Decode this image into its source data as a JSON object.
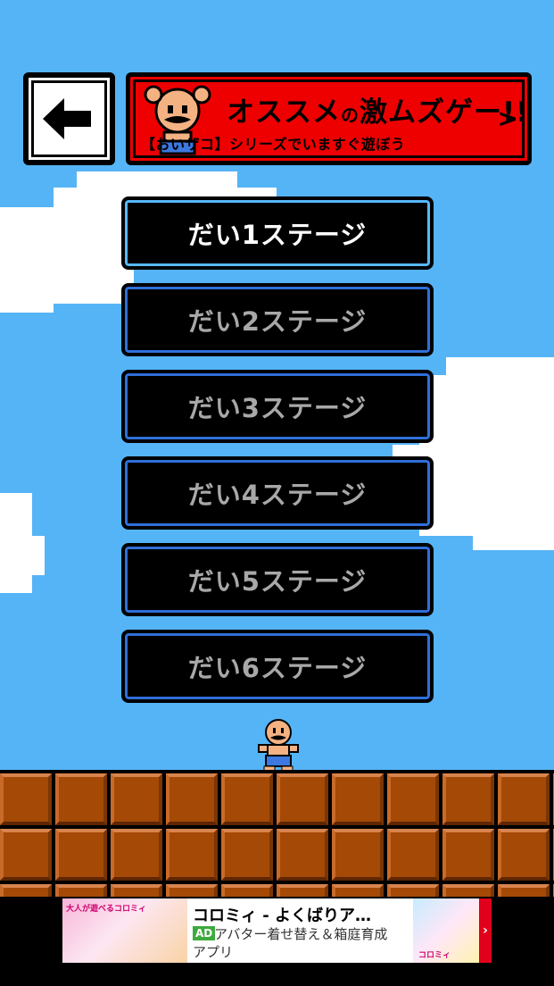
{
  "banner": {
    "title_main": "オススメ",
    "title_particle": "の",
    "title_rest": "激ムズゲー!!",
    "subtitle": "【おいザコ】シリーズでいますぐ遊ぼう",
    "chevron": ">"
  },
  "back_button": {
    "icon": "left-arrow-icon"
  },
  "stages": [
    {
      "label": "だい1ステージ",
      "active": true
    },
    {
      "label": "だい2ステージ",
      "active": false
    },
    {
      "label": "だい3ステージ",
      "active": false
    },
    {
      "label": "だい4ステージ",
      "active": false
    },
    {
      "label": "だい5ステージ",
      "active": false
    },
    {
      "label": "だい6ステージ",
      "active": false
    }
  ],
  "ad": {
    "title": "コロミィ - よくばりア…",
    "badge": "AD",
    "description_line1": "アバター着せ替え＆箱庭育成",
    "description_line2": "アプリ",
    "left_image_text": "大人が遊べるコロミィ",
    "right_image_text": "コロミィ",
    "close_glyph": "›"
  },
  "colors": {
    "sky": "#55b4f6",
    "banner_red": "#ee0000",
    "brick": "#a44a06",
    "stage_border_active": "#57b8ff",
    "stage_border": "#2f6fd9"
  }
}
